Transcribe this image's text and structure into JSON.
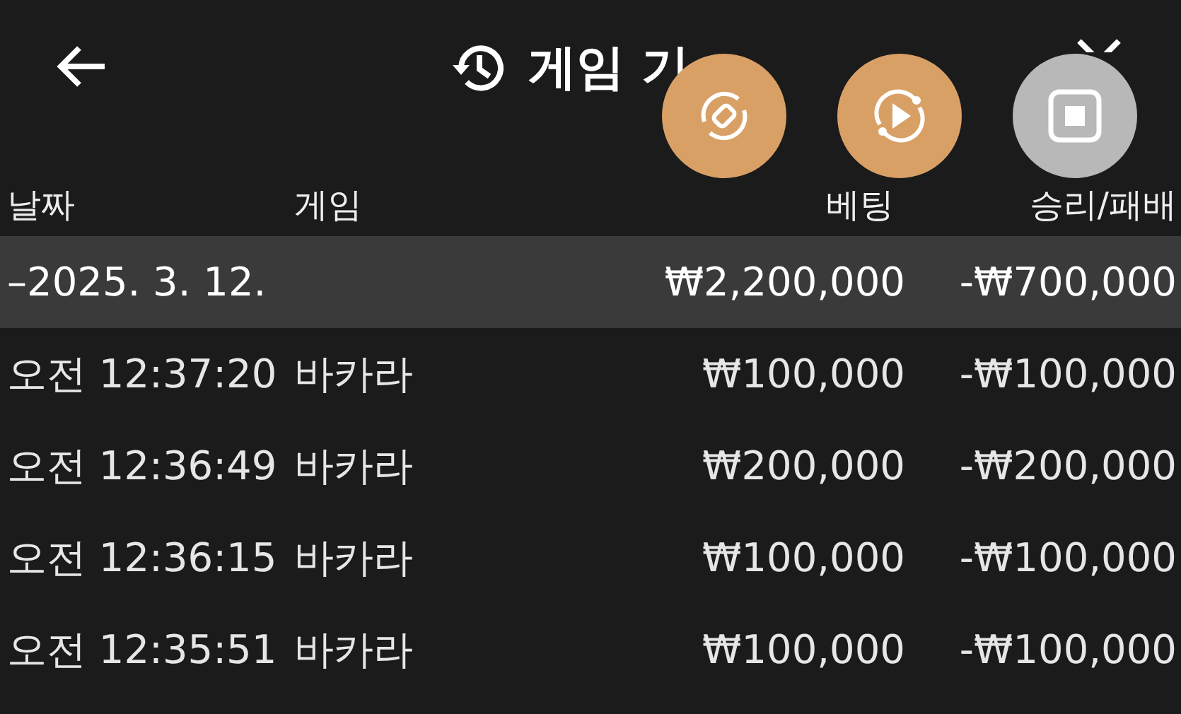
{
  "header": {
    "title": "게임 기"
  },
  "floating_buttons": [
    {
      "kind": "rotate",
      "color": "#d9a066"
    },
    {
      "kind": "play",
      "color": "#d9a066"
    },
    {
      "kind": "stop",
      "color": "#b8b8b8"
    }
  ],
  "table": {
    "columns": [
      "날짜",
      "게임",
      "베팅",
      "승리/패배"
    ],
    "rows": [
      {
        "kind": "group",
        "cells": [
          "–2025. 3. 12.",
          "",
          "₩2,200,000",
          "-₩700,000"
        ]
      },
      {
        "kind": "entry",
        "cells": [
          "오전 12:37:20",
          "바카라",
          "₩100,000",
          "-₩100,000"
        ]
      },
      {
        "kind": "entry",
        "cells": [
          "오전 12:36:49",
          "바카라",
          "₩200,000",
          "-₩200,000"
        ]
      },
      {
        "kind": "entry",
        "cells": [
          "오전 12:36:15",
          "바카라",
          "₩100,000",
          "-₩100,000"
        ]
      },
      {
        "kind": "entry",
        "cells": [
          "오전 12:35:51",
          "바카라",
          "₩100,000",
          "-₩100,000"
        ]
      }
    ]
  }
}
